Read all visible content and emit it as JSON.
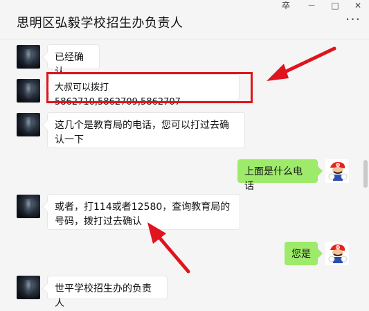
{
  "window": {
    "title": "思明区弘毅学校招生办负责人",
    "controls": {
      "pin": "卒",
      "minimize": "－",
      "maximize": "□",
      "close": "✕"
    },
    "more": "···"
  },
  "messages": [
    {
      "side": "left",
      "avatar": "dark-avatar",
      "text": "已经确认"
    },
    {
      "side": "left",
      "avatar": "dark-avatar",
      "text": "大叔可以拨打5862710,5862709,5862707",
      "highlighted": true
    },
    {
      "side": "left",
      "avatar": "dark-avatar",
      "text": "这几个是教育局的电话，您可以打过去确认一下"
    },
    {
      "side": "right",
      "avatar": "mario-avatar",
      "text": "上面是什么电话"
    },
    {
      "side": "left",
      "avatar": "dark-avatar",
      "text": "或者，打114或者12580，查询教育局的号码，拨打过去确认"
    },
    {
      "side": "right",
      "avatar": "mario-avatar",
      "text": "您是"
    },
    {
      "side": "left",
      "avatar": "dark-avatar",
      "text": "世平学校招生办的负责人"
    }
  ],
  "annotation": {
    "color": "#e0141e",
    "shape": "red-rectangle-and-arrows"
  },
  "colors": {
    "right_bubble": "#9eea6a",
    "left_bubble": "#ffffff",
    "background": "#f5f5f5"
  }
}
